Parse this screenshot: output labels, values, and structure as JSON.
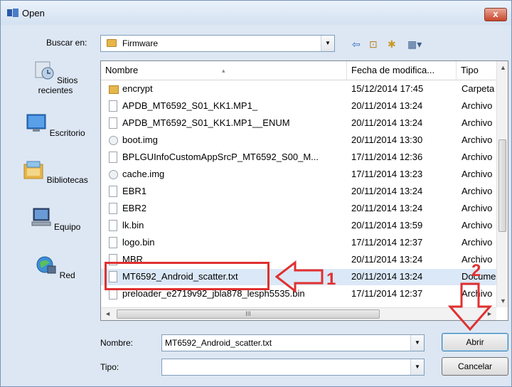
{
  "window": {
    "title": "Open",
    "close_label": "x"
  },
  "toolbar": {
    "look_in_label": "Buscar en:",
    "look_in_value": "Firmware",
    "back_glyph": "⇦",
    "up_glyph": "⊡",
    "newfolder_glyph": "✱",
    "view_glyph": "▦▾"
  },
  "places": [
    {
      "label": "Sitios recientes",
      "icon": "recent-places-icon"
    },
    {
      "label": "Escritorio",
      "icon": "desktop-icon"
    },
    {
      "label": "Bibliotecas",
      "icon": "libraries-icon"
    },
    {
      "label": "Equipo",
      "icon": "computer-icon"
    },
    {
      "label": "Red",
      "icon": "network-icon"
    }
  ],
  "columns": {
    "name": "Nombre",
    "date": "Fecha de modifica...",
    "type": "Tipo"
  },
  "files": [
    {
      "name": "encrypt",
      "date": "15/12/2014 17:45",
      "type": "Carpeta",
      "kind": "folder"
    },
    {
      "name": "APDB_MT6592_S01_KK1.MP1_",
      "date": "20/11/2014 13:24",
      "type": "Archivo",
      "kind": "file"
    },
    {
      "name": "APDB_MT6592_S01_KK1.MP1__ENUM",
      "date": "20/11/2014 13:24",
      "type": "Archivo",
      "kind": "file"
    },
    {
      "name": "boot.img",
      "date": "20/11/2014 13:30",
      "type": "Archivo",
      "kind": "img"
    },
    {
      "name": "BPLGUInfoCustomAppSrcP_MT6592_S00_M...",
      "date": "17/11/2014 12:36",
      "type": "Archivo",
      "kind": "file"
    },
    {
      "name": "cache.img",
      "date": "17/11/2014 13:23",
      "type": "Archivo",
      "kind": "img"
    },
    {
      "name": "EBR1",
      "date": "20/11/2014 13:24",
      "type": "Archivo",
      "kind": "file"
    },
    {
      "name": "EBR2",
      "date": "20/11/2014 13:24",
      "type": "Archivo",
      "kind": "file"
    },
    {
      "name": "lk.bin",
      "date": "20/11/2014 13:59",
      "type": "Archivo",
      "kind": "file"
    },
    {
      "name": "logo.bin",
      "date": "17/11/2014 12:37",
      "type": "Archivo",
      "kind": "file"
    },
    {
      "name": "MBR",
      "date": "20/11/2014 13:24",
      "type": "Archivo",
      "kind": "file"
    },
    {
      "name": "MT6592_Android_scatter.txt",
      "date": "20/11/2014 13:24",
      "type": "Documento",
      "kind": "file",
      "selected": true
    },
    {
      "name": "preloader_e2719v92_jbla878_lesph5535.bin",
      "date": "17/11/2014 12:37",
      "type": "Archivo",
      "kind": "file"
    }
  ],
  "scroll": {
    "hthumb_grip": "III",
    "up_arrow": "▲",
    "down_arrow": "▼",
    "left_arrow": "◄",
    "right_arrow": "►"
  },
  "bottom": {
    "name_label": "Nombre:",
    "name_value": "MT6592_Android_scatter.txt",
    "type_label": "Tipo:",
    "type_value": "",
    "open_button": "Abrir",
    "cancel_button": "Cancelar",
    "combo_arrow": "▼"
  },
  "annotations": {
    "step1": "1",
    "step2": "2",
    "color": "#e03030"
  }
}
